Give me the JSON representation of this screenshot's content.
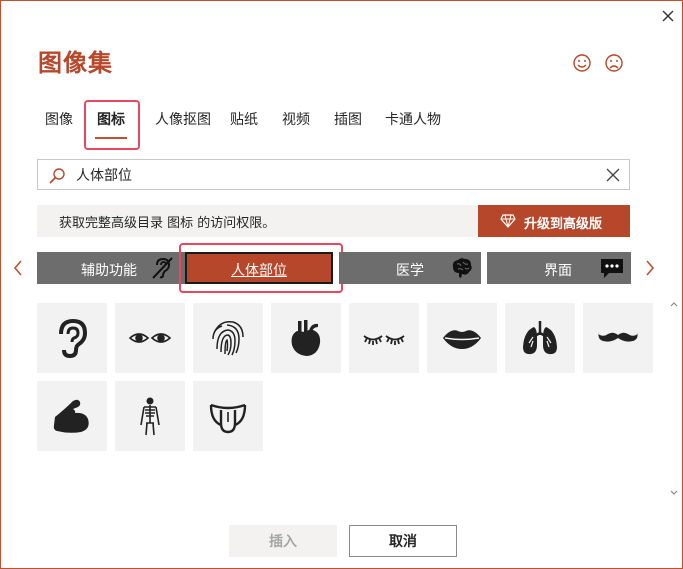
{
  "dialog": {
    "title": "图像集",
    "close_icon": "close-icon",
    "feedback": {
      "smile_icon": "smile-icon",
      "frown_icon": "frown-icon"
    }
  },
  "tabs": [
    {
      "label": "图像",
      "active": false
    },
    {
      "label": "图标",
      "active": true
    },
    {
      "label": "人像抠图",
      "active": false
    },
    {
      "label": "贴纸",
      "active": false
    },
    {
      "label": "视频",
      "active": false
    },
    {
      "label": "插图",
      "active": false
    },
    {
      "label": "卡通人物",
      "active": false
    }
  ],
  "search": {
    "value": "人体部位",
    "icon": "search-icon",
    "clear_icon": "close-icon"
  },
  "banner": {
    "text": "获取完整高级目录 图标 的访问权限。",
    "upgrade_label": "升级到高级版",
    "upgrade_icon": "diamond-icon"
  },
  "categories": [
    {
      "label": "辅助功能",
      "icon": "hearing-disabled-icon",
      "active": false
    },
    {
      "label": "人体部位",
      "icon": "",
      "active": true
    },
    {
      "label": "医学",
      "icon": "brain-icon",
      "active": false
    },
    {
      "label": "界面",
      "icon": "chat-bubble-icon",
      "active": false
    }
  ],
  "icons": [
    {
      "name": "ear-icon"
    },
    {
      "name": "eyes-icon"
    },
    {
      "name": "fingerprint-icon"
    },
    {
      "name": "heart-organ-icon"
    },
    {
      "name": "eyelashes-icon"
    },
    {
      "name": "lips-icon"
    },
    {
      "name": "lungs-icon"
    },
    {
      "name": "mustache-icon"
    },
    {
      "name": "flexed-arm-icon"
    },
    {
      "name": "skeleton-icon"
    },
    {
      "name": "tongue-icon"
    }
  ],
  "footer": {
    "insert_label": "插入",
    "insert_enabled": false,
    "cancel_label": "取消"
  },
  "colors": {
    "accent": "#b7472a",
    "highlight": "#e8475f",
    "category_bg": "#6d6d6d",
    "tile_bg": "#f2f2f2"
  }
}
